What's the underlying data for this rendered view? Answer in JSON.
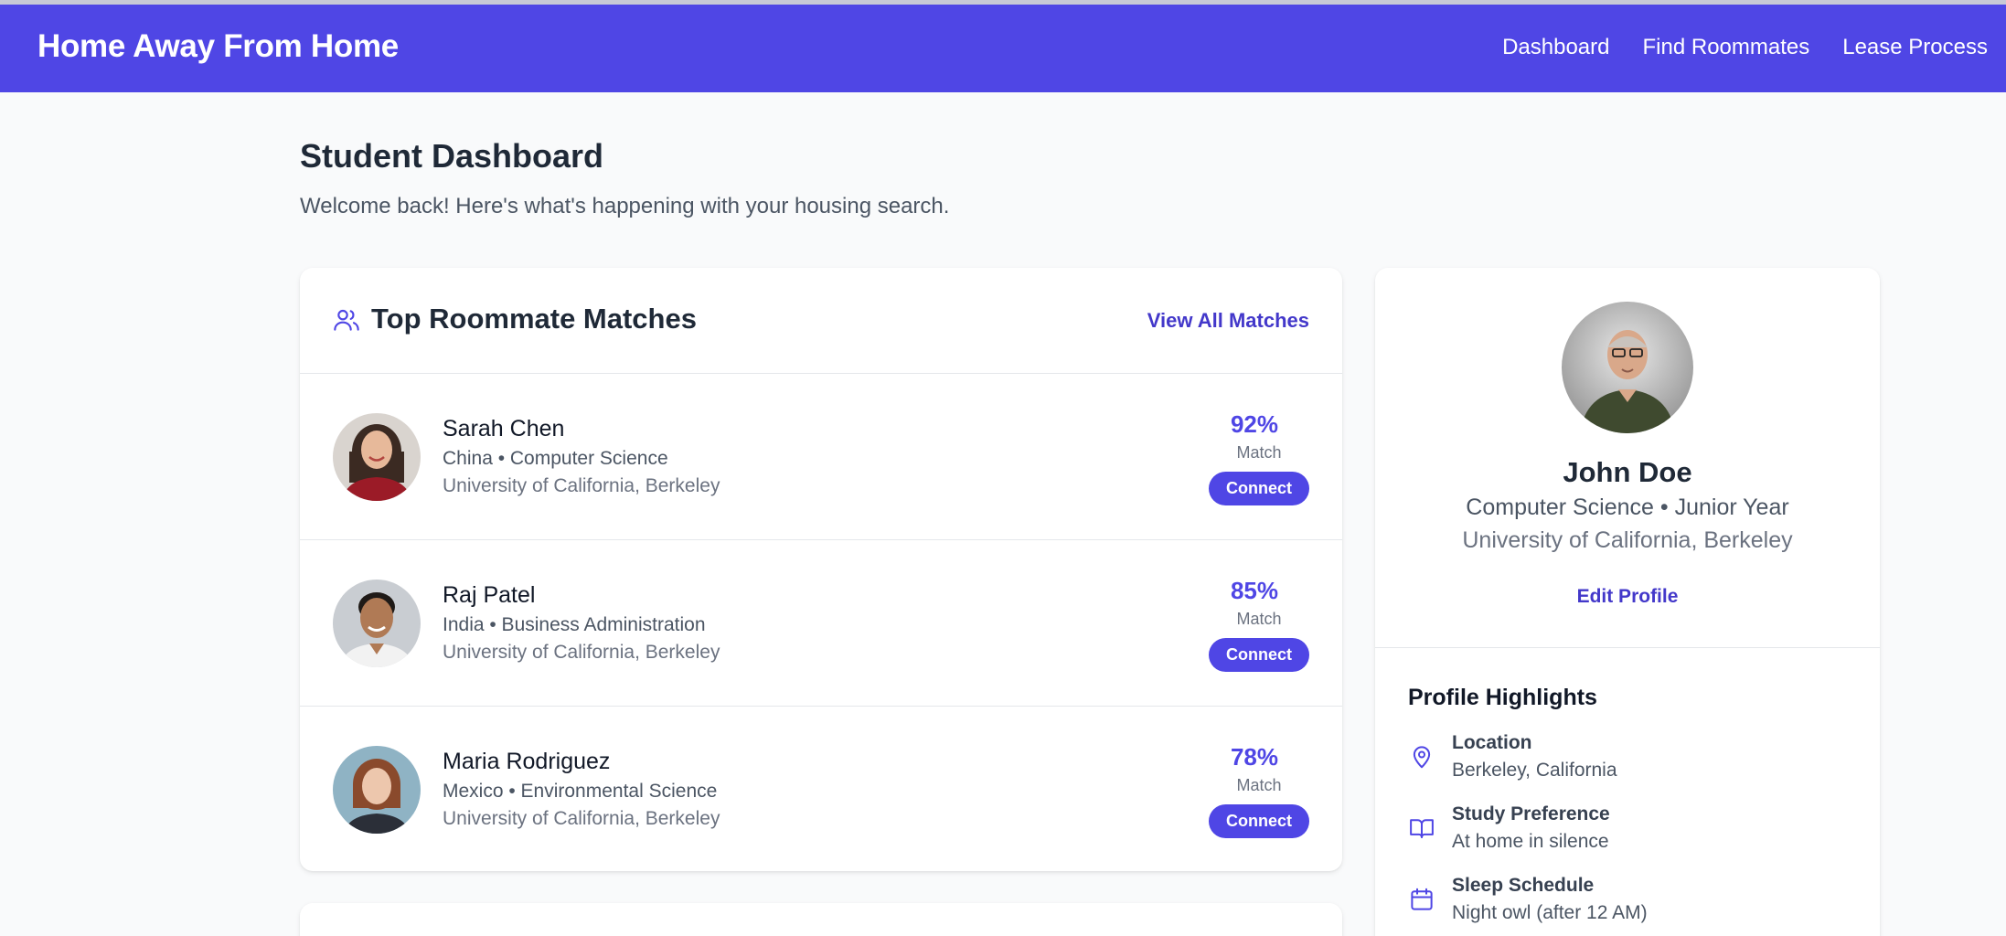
{
  "nav": {
    "brand": "Home Away From Home",
    "links": [
      "Dashboard",
      "Find Roommates",
      "Lease Process"
    ]
  },
  "page": {
    "title": "Student Dashboard",
    "subtitle": "Welcome back! Here's what's happening with your housing search."
  },
  "matches": {
    "title": "Top Roommate Matches",
    "view_all": "View All Matches",
    "items": [
      {
        "name": "Sarah Chen",
        "country": "China",
        "major": "Computer Science",
        "line2": "China • Computer Science",
        "university": "University of California, Berkeley",
        "score": "92%",
        "score_label": "Match",
        "connect": "Connect"
      },
      {
        "name": "Raj Patel",
        "country": "India",
        "major": "Business Administration",
        "line2": "India • Business Administration",
        "university": "University of California, Berkeley",
        "score": "85%",
        "score_label": "Match",
        "connect": "Connect"
      },
      {
        "name": "Maria Rodriguez",
        "country": "Mexico",
        "major": "Environmental Science",
        "line2": "Mexico • Environmental Science",
        "university": "University of California, Berkeley",
        "score": "78%",
        "score_label": "Match",
        "connect": "Connect"
      }
    ]
  },
  "profile": {
    "name": "John Doe",
    "line2": "Computer Science • Junior Year",
    "university": "University of California, Berkeley",
    "edit": "Edit Profile",
    "highlights_title": "Profile Highlights",
    "highlights": [
      {
        "icon": "map-pin-icon",
        "label": "Location",
        "value": "Berkeley, California"
      },
      {
        "icon": "book-open-icon",
        "label": "Study Preference",
        "value": "At home in silence"
      },
      {
        "icon": "calendar-icon",
        "label": "Sleep Schedule",
        "value": "Night owl (after 12 AM)"
      }
    ]
  },
  "colors": {
    "primary": "#4f46e5",
    "link": "#4338ca",
    "background": "#f9fafb",
    "card": "#ffffff",
    "divider": "#e5e7eb"
  }
}
